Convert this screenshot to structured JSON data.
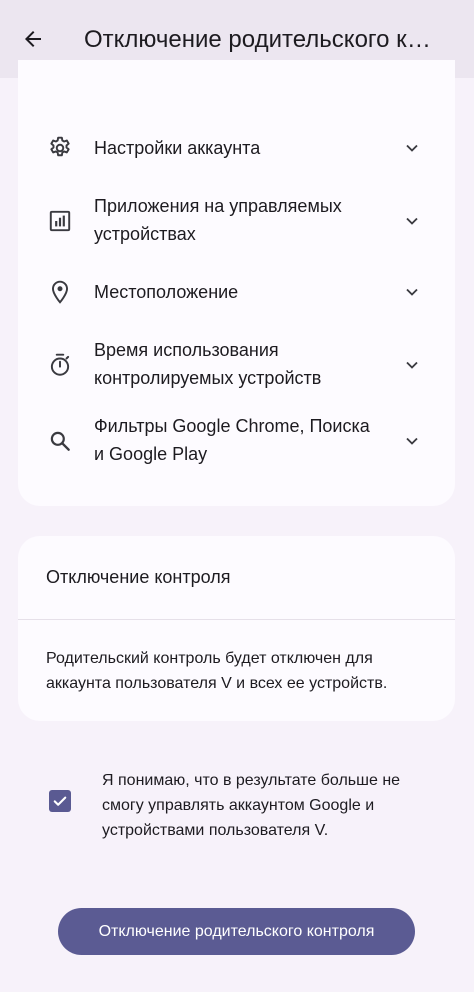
{
  "appbar": {
    "back_icon": "arrow-left-icon",
    "title": "Отключение родительского контроля"
  },
  "features": [
    {
      "icon": "gear-icon",
      "label": "Настройки аккаунта"
    },
    {
      "icon": "bar-chart-icon",
      "label": "Приложения на управляемых устройствах"
    },
    {
      "icon": "location-pin-icon",
      "label": "Местоположение"
    },
    {
      "icon": "timer-icon",
      "label": "Время использования контролируемых устройств"
    },
    {
      "icon": "search-icon",
      "label": "Фильтры Google Chrome, Поиска и Google Play"
    }
  ],
  "disable_card": {
    "title": "Отключение контроля",
    "body": "Родительский контроль будет отключен для аккаунта пользователя V и всех ее устройств."
  },
  "acknowledge": {
    "checked": true,
    "label": "Я понимаю, что в результате больше не смогу управлять аккаунтом Google и устройствами пользователя V."
  },
  "primary_button": {
    "label": "Отключение родительского контроля"
  },
  "colors": {
    "background": "#f7f2fa",
    "appbar": "#ece6f0",
    "card": "#fdfbff",
    "accent": "#5b5b93",
    "icon": "#3a3a40"
  }
}
